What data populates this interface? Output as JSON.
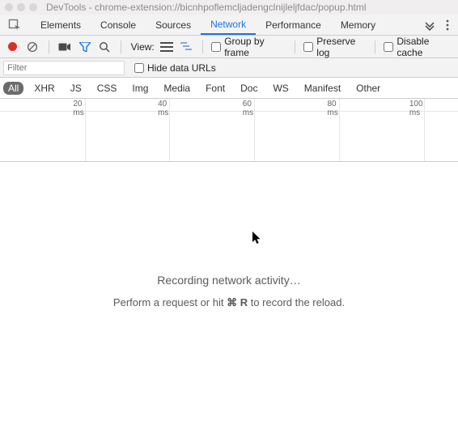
{
  "titlebar": {
    "title": "DevTools - chrome-extension://bicnhpoflemcljadengclnijleljfdac/popup.html"
  },
  "tabs": {
    "items": [
      "Elements",
      "Console",
      "Sources",
      "Network",
      "Performance",
      "Memory"
    ],
    "active_index": 3
  },
  "toolbar": {
    "view_label": "View:",
    "group_by_frame": "Group by frame",
    "preserve_log": "Preserve log",
    "disable_cache": "Disable cache"
  },
  "filterbar": {
    "placeholder": "Filter",
    "hide_data_urls": "Hide data URLs"
  },
  "types": {
    "items": [
      "All",
      "XHR",
      "JS",
      "CSS",
      "Img",
      "Media",
      "Font",
      "Doc",
      "WS",
      "Manifest",
      "Other"
    ],
    "active_index": 0
  },
  "timeline": {
    "ticks": [
      "20 ms",
      "40 ms",
      "60 ms",
      "80 ms",
      "100 ms"
    ]
  },
  "empty": {
    "title": "Recording network activity…",
    "hint_pre": "Perform a request or hit ",
    "hint_key": "⌘ R",
    "hint_post": " to record the reload."
  }
}
